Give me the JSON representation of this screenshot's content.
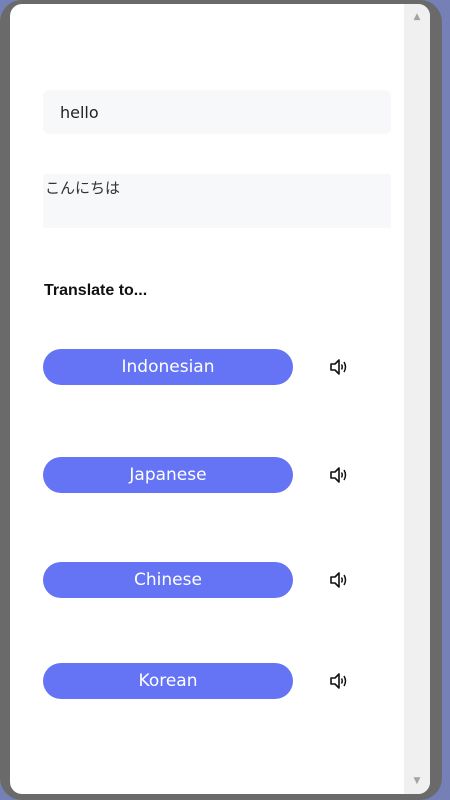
{
  "source": {
    "value": "hello"
  },
  "output": {
    "text": "こんにちは"
  },
  "heading": "Translate to...",
  "languages": [
    {
      "label": "Indonesian"
    },
    {
      "label": "Japanese"
    },
    {
      "label": "Chinese"
    },
    {
      "label": "Korean"
    }
  ],
  "colors": {
    "button": "#6574f5",
    "input_bg": "#f7f8fa",
    "frame": "#6a6a6a",
    "backdrop": "#7581b6"
  }
}
